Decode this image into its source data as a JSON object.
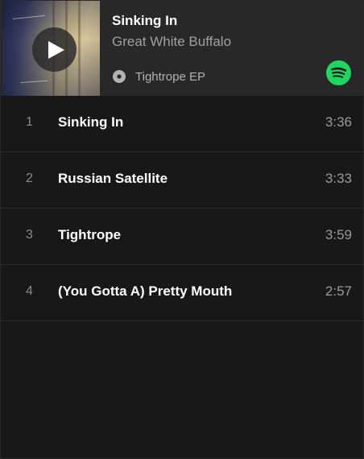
{
  "header": {
    "track_title": "Sinking In",
    "artist": "Great White Buffalo",
    "album": "Tightrope EP",
    "album_icon": "album-disc-icon",
    "brand_logo": "spotify-logo",
    "brand_color": "#1ed760"
  },
  "tracks": [
    {
      "number": "1",
      "title": "Sinking In",
      "duration": "3:36"
    },
    {
      "number": "2",
      "title": "Russian Satellite",
      "duration": "3:33"
    },
    {
      "number": "3",
      "title": "Tightrope",
      "duration": "3:59"
    },
    {
      "number": "4",
      "title": "(You Gotta A) Pretty Mouth",
      "duration": "2:57"
    }
  ]
}
